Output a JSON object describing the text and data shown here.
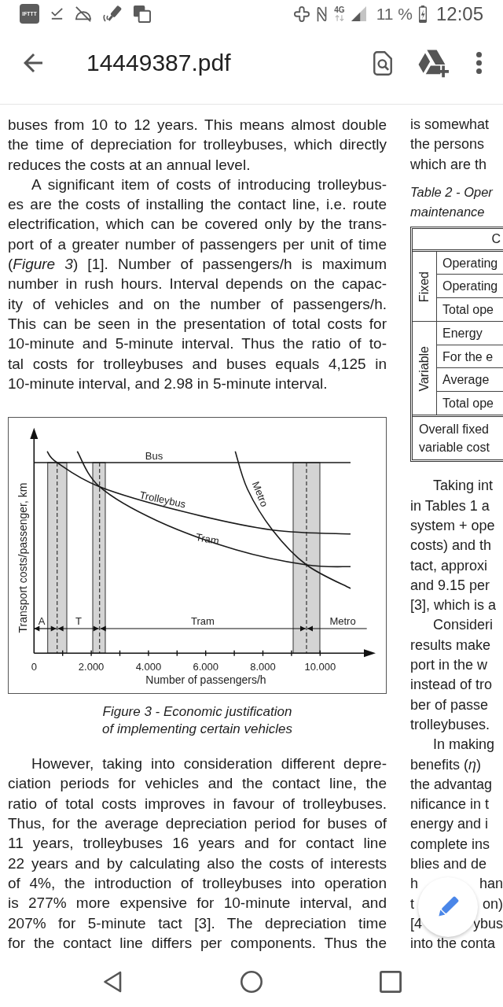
{
  "status_bar": {
    "app_logo": "IFTTT",
    "network_type": "4G",
    "battery_percent": "11 %",
    "time": "12:05"
  },
  "app_bar": {
    "title": "14449387.pdf"
  },
  "document": {
    "left_column": {
      "paragraphs_top": [
        {
          "indented": false,
          "continues": false,
          "lines": [
            "buses from 10 to 12 years. This means almost double",
            "the time of depreciation for trolleybuses, which directly",
            "reduces the costs at an annual level."
          ]
        },
        {
          "indented": true,
          "continues": false,
          "lines": [
            "A significant item of costs of introducing trolleybus-",
            "es are the costs of installing the contact line, i.e. route",
            "electrification, which can be covered only by the trans-",
            "port of a greater number of passengers per unit of time",
            "(*Figure 3*) [1]. Number of passengers/h is maximum",
            "number in rush hours. Interval depends on the capac-",
            "ity of vehicles and on the number of passengers/h.",
            "This can be seen in the presentation of total costs for",
            "10-minute and 5-minute interval. Thus the ratio of to-",
            "tal costs for trolleybuses and buses equals 4,125 in",
            "10-minute interval, and 2.98 in 5-minute interval."
          ]
        }
      ],
      "figure": {
        "y_axis_title": "Transport costs/passenger, km",
        "x_axis_title": "Number of passengers/h",
        "x_tick_labels": [
          "0",
          "2.000",
          "4.000",
          "6.000",
          "8.000",
          "10.000"
        ],
        "curve_labels": [
          "Bus",
          "Trolleybus",
          "Tram",
          "Metro"
        ],
        "range_labels": [
          "A",
          "T",
          "Tram",
          "Metro"
        ],
        "caption": [
          "Figure 3 - Economic justification",
          "of implementing certain vehicles"
        ]
      },
      "paragraphs_bottom": [
        {
          "indented": true,
          "continues": true,
          "lines": [
            "However, taking into consideration different depre-",
            "ciation periods for vehicles and the contact line, the",
            "ratio of total costs improves in favour of trolleybuses.",
            "Thus, for the average depreciation period for buses of",
            "11 years, trolleybuses 16 years and for contact line",
            "22 years and by calculating also the costs of interests",
            "of 4%, the introduction of trolleybuses into operation",
            "is 277% more expensive for 10-minute interval, and",
            "207% for 5-minute tact [3]. The depreciation time",
            "for the contact line differs per components. Thus the"
          ]
        }
      ]
    },
    "right_column": {
      "paragraphs_top": [
        {
          "indented": false,
          "lines": [
            "is somewhat",
            "the persons",
            "which are th"
          ]
        }
      ],
      "table": {
        "caption": [
          "Table 2 - Oper",
          "maintenance"
        ],
        "header": "C",
        "groups": [
          {
            "label": "Fixed",
            "rows": [
              "Operating",
              "Operating",
              "Total ope"
            ]
          },
          {
            "label": "Variable",
            "rows": [
              "Energy",
              "For the e",
              "Average",
              "Total ope"
            ]
          }
        ],
        "footer": [
          "Overall fixed",
          "variable cost"
        ]
      },
      "paragraphs_bottom": [
        {
          "indented": true,
          "lines": [
            "Taking int",
            "in Tables 1 a",
            "system + ope",
            "costs) and th",
            "tact, approxi",
            "and 9.15 per",
            "[3], which is a"
          ]
        },
        {
          "indented": true,
          "lines": [
            "Consideri",
            "results make",
            "port in the w",
            "instead of tro",
            "ber of passe",
            "trolleybuses."
          ]
        },
        {
          "indented": true,
          "lines": [
            "In making",
            "benefits (*η*)",
            "the advantag",
            "nificance in t",
            "energy and i",
            "complete ins",
            "blies and de",
            [
              "h",
              "han"
            ],
            [
              "t",
              "on)"
            ],
            [
              "[4",
              "ybus"
            ],
            "into the conta"
          ]
        }
      ]
    }
  }
}
